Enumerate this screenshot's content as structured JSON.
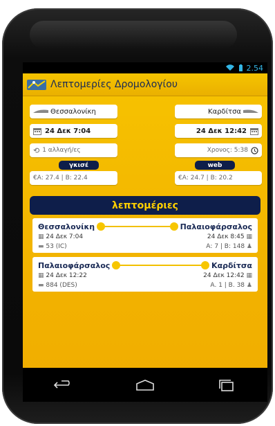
{
  "status": {
    "time": "2.54"
  },
  "appbar": {
    "title": "Λεπτομερίες Δρομολογίου"
  },
  "summary": {
    "from_city": "Θεσσαλονίκη",
    "to_city": "Καρδίτσα",
    "departure": "24 Δεκ 7:04",
    "arrival": "24 Δεκ 12:42",
    "changes": "1 αλλαγή/ες",
    "duration": "Χρονος: 5:38",
    "fare_left_label": "γκισέ",
    "fare_right_label": "web",
    "fare_left": "€Α: 27.4 | Β: 22.4",
    "fare_right": "€Α: 24.7 | Β: 20.2"
  },
  "details_label": "λεπτομέριες",
  "legs": [
    {
      "from": "Θεσσαλονίκη",
      "to": "Παλαιοφάρσαλος",
      "depart": "24 Δεκ 7:04",
      "arrive": "24 Δεκ 8:45",
      "train": "53 (IC)",
      "seats": "Α: 7 | Β: 148"
    },
    {
      "from": "Παλαιοφάρσαλος",
      "to": "Καρδίτσα",
      "depart": "24 Δεκ 12:22",
      "arrive": "24 Δεκ 12:42",
      "train": "884 (DES)",
      "seats": "Α. 1 | Β. 38"
    }
  ],
  "colors": {
    "accent": "#f2b100",
    "navy": "#0e1e4a",
    "status_blue": "#33b5e5"
  },
  "icons": [
    "wifi-icon",
    "battery-icon",
    "train-icon",
    "calendar-icon",
    "refresh-icon",
    "clock-icon",
    "seat-icon",
    "back-icon",
    "home-icon",
    "recent-apps-icon"
  ]
}
